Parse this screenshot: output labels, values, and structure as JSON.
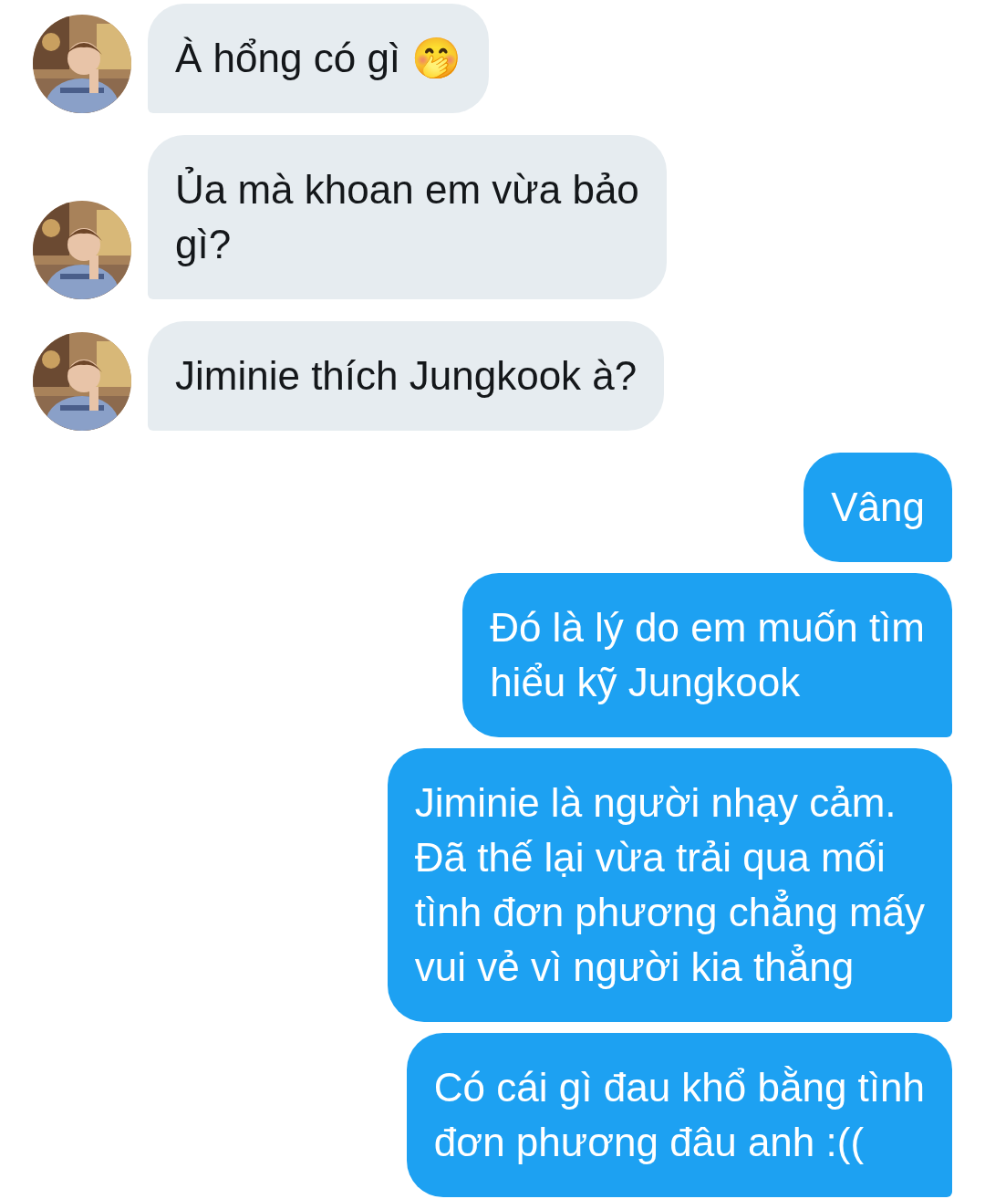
{
  "messages": [
    {
      "kind": "incoming",
      "text": "À hổng có gì 🤭"
    },
    {
      "kind": "incoming",
      "text": "Ủa mà khoan em vừa bảo\ngì?"
    },
    {
      "kind": "incoming",
      "text": "Jiminie thích Jungkook à?"
    },
    {
      "kind": "outgoing",
      "text": "Vâng"
    },
    {
      "kind": "outgoing",
      "text": "Đó là lý do em muốn tìm\nhiểu kỹ Jungkook"
    },
    {
      "kind": "outgoing",
      "text": "Jiminie là người nhạy cảm.\nĐã thế lại vừa trải qua mối\ntình đơn phương chẳng mấy\nvui vẻ vì người kia thẳng"
    },
    {
      "kind": "outgoing",
      "text": "Có cái gì đau khổ bằng tình\nđơn phương đâu anh :(("
    }
  ]
}
